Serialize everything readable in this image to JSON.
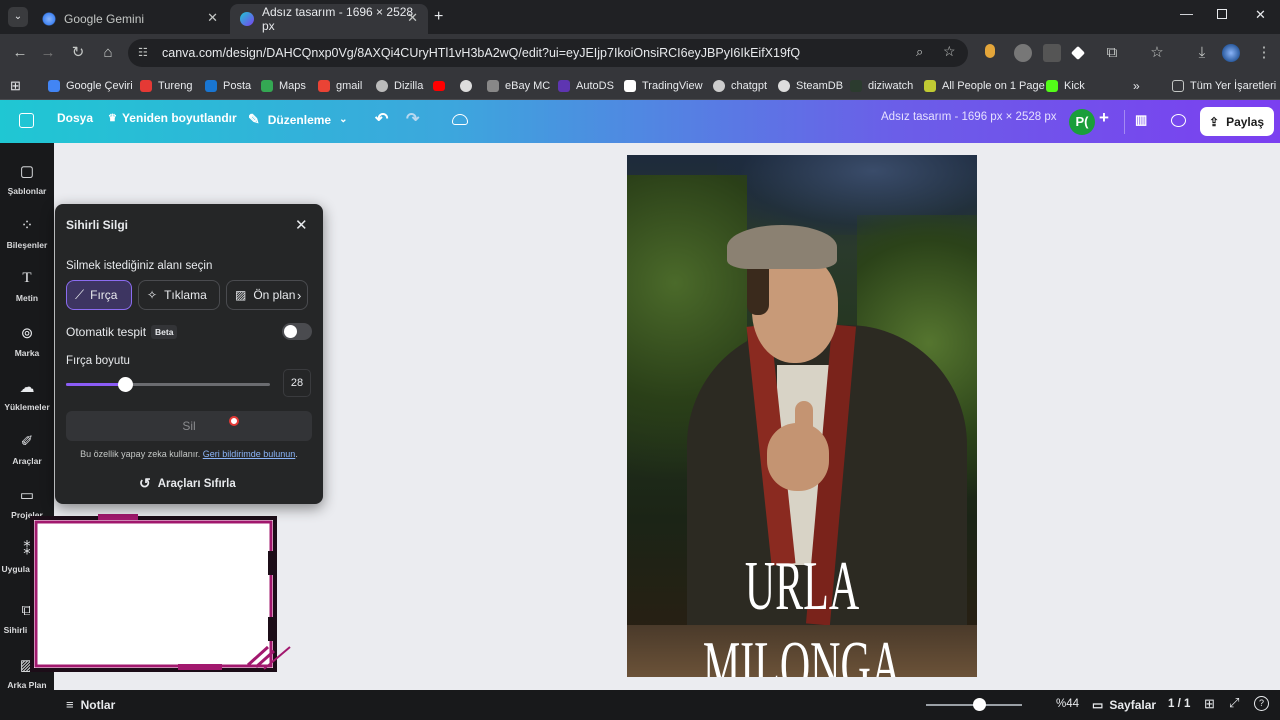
{
  "browser": {
    "tabs": [
      {
        "title": "Google Gemini",
        "active": false
      },
      {
        "title": "Adsız tasarım - 1696 × 2528 px",
        "active": true
      }
    ],
    "url": "canva.com/design/DAHCQnxp0Vg/8AXQi4CUryHTl1vH3bA2wQ/edit?ui=eyJEIjp7IkoiOnsiRCI6eyJBPyI6IkEifX19fQ",
    "bookmarks": [
      "Google Çeviri",
      "Tureng",
      "Posta",
      "Maps",
      "gmail",
      "Dizilla",
      "",
      "",
      "eBay MC",
      "AutoDS",
      "TradingView",
      "chatgpt",
      "SteamDB",
      "diziwatch",
      "All People on 1 Page",
      "Kick"
    ],
    "all_bookmarks": "Tüm Yer İşaretleri"
  },
  "canva_header": {
    "file": "Dosya",
    "resize": "Yeniden boyutlandır",
    "edit_mode": "Düzenleme",
    "design_title": "Adsız tasarım - 1696 px × 2528 px",
    "avatar": "P(",
    "share": "Paylaş"
  },
  "sidebar": [
    "Şablonlar",
    "Bileşenler",
    "Metin",
    "Marka",
    "Yüklemeler",
    "Araçlar",
    "Projeler",
    "Uygulamalar",
    "Sihirli Serik",
    "Arka Plan"
  ],
  "panel": {
    "title": "Sihirli Silgi",
    "select_label": "Silmek istediğiniz alanı seçin",
    "modes": [
      "Fırça",
      "Tıklama",
      "Ön plan"
    ],
    "auto_detect": "Otomatik tespit",
    "beta": "Beta",
    "auto_detect_on": false,
    "brush_label": "Fırça boyutu",
    "brush_value": "28",
    "brush_fraction": 0.29,
    "erase_button": "Sil",
    "ai_note": "Bu özellik yapay zeka kullanır.",
    "feedback_link": "Geri bildirimde bulunun",
    "reset": "Araçları Sıfırla"
  },
  "design": {
    "poster_text": "URLA MILONGA"
  },
  "bottom": {
    "notes": "Notlar",
    "zoom": "%44",
    "zoom_fraction": 0.55,
    "pages": "Sayfalar",
    "page_count": "1 / 1"
  },
  "colors": {
    "accent_purple": "#7b3ff0",
    "accent_cyan": "#1fc7d3",
    "frame_magenta": "#a2186e",
    "avatar_green": "#1a9e3a"
  }
}
